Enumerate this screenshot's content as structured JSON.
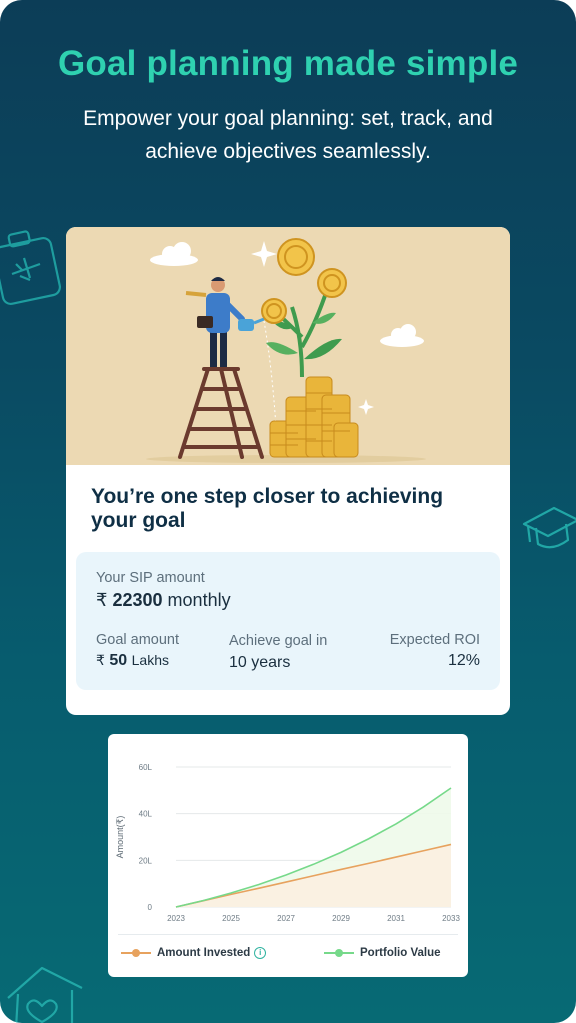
{
  "header": {
    "title": "Goal planning made simple",
    "subtitle": "Empower your goal planning: set, track, and achieve objectives seamlessly."
  },
  "card": {
    "title": "You’re one step closer to achieving your goal",
    "sip": {
      "label": "Your  SIP amount",
      "currency": "₹",
      "amount": "22300",
      "period": "monthly"
    },
    "goal_amount": {
      "label": "Goal amount",
      "currency": "₹",
      "value": "50",
      "unit": "Lakhs"
    },
    "achieve_in": {
      "label": "Achieve goal in",
      "value": "10 years"
    },
    "roi": {
      "label": "Expected ROI",
      "value": "12%"
    }
  },
  "chart_data": {
    "type": "area",
    "ylabel": "Amount(₹)",
    "y_ticks": [
      "0",
      "20L",
      "40L",
      "60L"
    ],
    "x_ticks": [
      "2023",
      "2025",
      "2027",
      "2029",
      "2031",
      "2033"
    ],
    "ylim": [
      0,
      60
    ],
    "x": [
      2023,
      2024,
      2025,
      2026,
      2027,
      2028,
      2029,
      2030,
      2031,
      2032,
      2033
    ],
    "series": [
      {
        "name": "Amount Invested",
        "color": "#e7a25e",
        "values": [
          0,
          2.7,
          5.4,
          8.0,
          10.7,
          13.4,
          16.1,
          18.7,
          21.4,
          24.1,
          26.8
        ]
      },
      {
        "name": "Portfolio Value",
        "color": "#76d98a",
        "values": [
          0,
          2.8,
          6.0,
          9.6,
          13.7,
          18.3,
          23.4,
          29.2,
          35.6,
          42.9,
          51.0
        ]
      }
    ],
    "grid": true,
    "legend_position": "bottom"
  },
  "icons": [
    "suitcase-icon",
    "graduation-cap-icon",
    "house-heart-icon",
    "info-icon"
  ]
}
